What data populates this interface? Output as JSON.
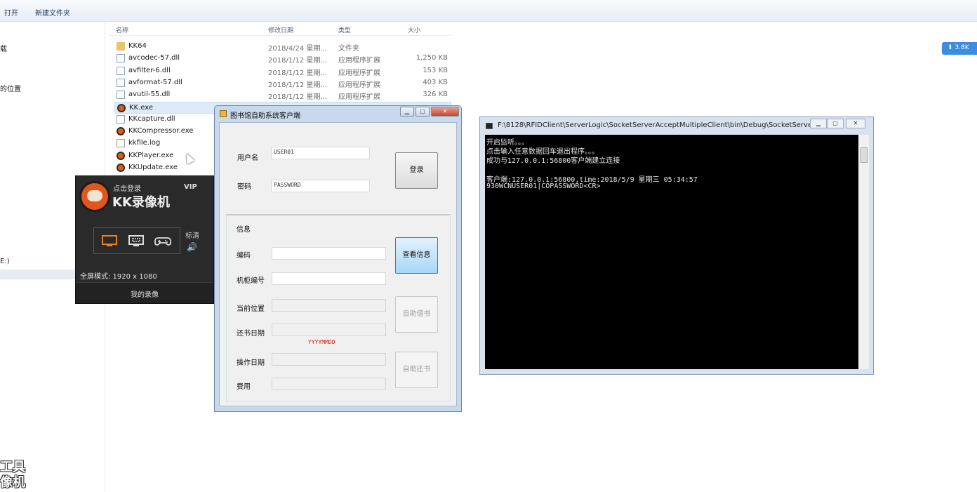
{
  "explorer": {
    "toolbar": {
      "open": "打开",
      "new_folder": "新建文件夹"
    },
    "nav_items": [
      "载",
      "的位置",
      "E:)"
    ],
    "columns": {
      "name": "名称",
      "modified": "修改日期",
      "type": "类型",
      "size": "大小"
    },
    "files": [
      {
        "name": "KK64",
        "date": "2018/4/24 星期...",
        "type": "文件夹",
        "size": "",
        "icon": "folder-icon"
      },
      {
        "name": "avcodec-57.dll",
        "date": "2018/1/12 星期...",
        "type": "应用程序扩展",
        "size": "1,250 KB",
        "icon": "dll-icon"
      },
      {
        "name": "avfilter-6.dll",
        "date": "2018/1/12 星期...",
        "type": "应用程序扩展",
        "size": "153 KB",
        "icon": "dll-icon"
      },
      {
        "name": "avformat-57.dll",
        "date": "2018/1/12 星期...",
        "type": "应用程序扩展",
        "size": "403 KB",
        "icon": "dll-icon"
      },
      {
        "name": "avutil-55.dll",
        "date": "2018/1/12 星期...",
        "type": "应用程序扩展",
        "size": "326 KB",
        "icon": "dll-icon"
      },
      {
        "name": "KK.exe",
        "date": "",
        "type": "",
        "size": "",
        "icon": "kk-exe-icon"
      },
      {
        "name": "KKcapture.dll",
        "date": "",
        "type": "",
        "size": "",
        "icon": "dll-icon"
      },
      {
        "name": "KKCompressor.exe",
        "date": "",
        "type": "",
        "size": "",
        "icon": "kk-exe-icon"
      },
      {
        "name": "kkfile.log",
        "date": "",
        "type": "",
        "size": "",
        "icon": "log-icon"
      },
      {
        "name": "KKPlayer.exe",
        "date": "",
        "type": "",
        "size": "",
        "icon": "kk-exe-icon"
      },
      {
        "name": "KKUpdate.exe",
        "date": "",
        "type": "",
        "size": "",
        "icon": "kk-exe-icon"
      }
    ],
    "download_speed": "3.8K",
    "watermark": [
      "工具",
      "像机"
    ]
  },
  "kk_recorder": {
    "login": "点击登录",
    "vip": "VIP",
    "title": "KK录像机",
    "quality": "标清",
    "status": "全屏模式: 1920 x 1080",
    "my_recordings": "我的录像"
  },
  "library_client": {
    "title": "图书馆自助系统客户端",
    "username_label": "用户名",
    "username_value": "USER01",
    "password_label": "密码",
    "password_value": "PASSWORD",
    "login_button": "登录",
    "group_title": "信息",
    "code_label": "编码",
    "cabinet_label": "机柜编号",
    "location_label": "当前位置",
    "return_date_label": "还书日期",
    "date_hint": "YYYYMMDD",
    "op_date_label": "操作日期",
    "fee_label": "费用",
    "query_button": "查看信息",
    "borrow_button": "自助借书",
    "return_button": "自助还书"
  },
  "console": {
    "title": "F:\\8128\\RFIDClient\\ServerLogic\\SocketServerAcceptMultipleClient\\bin\\Debug\\SocketServe...",
    "lines": [
      "开启监听。。。",
      "点击输入任意数据回车退出程序。。。",
      "成功与127.0.0.1:56800客户端建立连接",
      "",
      "客户端:127.0.0.1:56800,time:2018/5/9 星期三 05:34:57",
      "930WCNUSER01|COPASSWORD<CR>"
    ]
  }
}
